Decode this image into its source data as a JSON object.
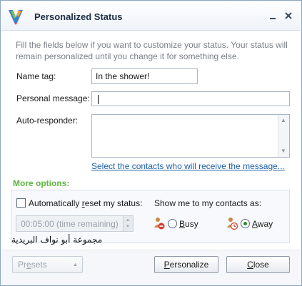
{
  "window": {
    "title": "Personalized Status"
  },
  "intro": {
    "text": "Fill the fields below if you want to customize your status. Your status will remain personalized until you change it for something else."
  },
  "fields": {
    "name_tag_label": "Name tag:",
    "name_tag_value": "In the shower!",
    "personal_message_label": "Personal message:",
    "personal_message_value": "",
    "auto_responder_label": "Auto-responder:",
    "auto_responder_value": ""
  },
  "contacts_link": "Select the contacts who will receive the message...",
  "more_options": {
    "heading": "More options:",
    "auto_reset_pre": "Automatically ",
    "auto_reset_underlined": "r",
    "auto_reset_post": "eset my status:",
    "auto_reset_checked": false,
    "time_remaining": "00:05:00 (time remaining)",
    "show_label": "Show me to my contacts as:",
    "busy_pre": "",
    "busy_underlined": "B",
    "busy_post": "usy",
    "away_pre": "",
    "away_underlined": "A",
    "away_post": "way",
    "selected": "away"
  },
  "watermark": "مجموعة أبو نواف البريدية",
  "buttons": {
    "presets_pre": "Pr",
    "presets_underlined": "e",
    "presets_post": "sets",
    "personalize_pre": "",
    "personalize_underlined": "P",
    "personalize_post": "ersonalize",
    "close_pre": "",
    "close_underlined": "C",
    "close_post": "lose"
  },
  "colors": {
    "accent_green": "#5fb544",
    "link_blue": "#1c5fa8",
    "intro_gray": "#7a7f86"
  }
}
